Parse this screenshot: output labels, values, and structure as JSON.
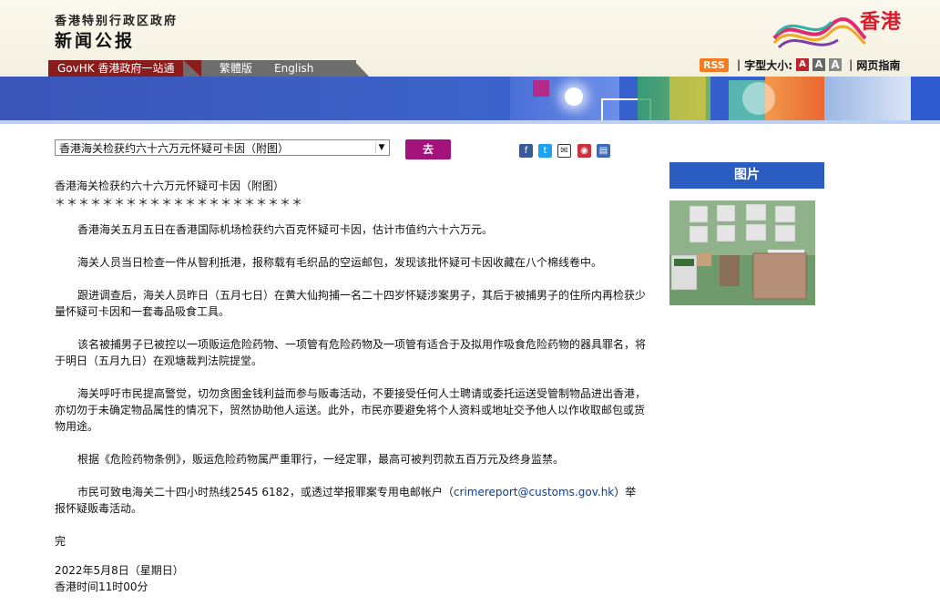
{
  "header": {
    "gov_name": "香港特别行政区政府",
    "site_name": "新闻公报",
    "logo_text": "香港"
  },
  "toolbar": {
    "rss": "RSS",
    "font_size_label": "字型大小:",
    "font_a": "A",
    "guide": "网页指南"
  },
  "nav": {
    "govhk": "GovHK 香港政府一站通",
    "traditional": "繁體版",
    "english": "English"
  },
  "select": {
    "value": "香港海关检获约六十六万元怀疑可卡因（附图）"
  },
  "go_button": "去",
  "article": {
    "title": "香港海关检获约六十六万元怀疑可卡因（附图）",
    "stars": "＊＊＊＊＊＊＊＊＊＊＊＊＊＊＊＊＊＊＊＊＊",
    "p1": "香港海关五月五日在香港国际机场检获约六百克怀疑可卡因，估计市值约六十六万元。",
    "p2": "海关人员当日检查一件从智利抵港，报称载有毛织品的空运邮包，发现该批怀疑可卡因收藏在八个棉线卷中。",
    "p3": "跟进调查后，海关人员昨日（五月七日）在黄大仙拘捕一名二十四岁怀疑涉案男子，其后于被捕男子的住所内再检获少量怀疑可卡因和一套毒品吸食工具。",
    "p4": "该名被捕男子已被控以一项贩运危险药物、一项管有危险药物及一项管有适合于及拟用作吸食危险药物的器具罪名，将于明日（五月九日）在观塘裁判法院提堂。",
    "p5": "海关呼吁市民提高警觉，切勿贪图金钱利益而参与贩毒活动，不要接受任何人士聘请或委托运送受管制物品进出香港，亦切勿于未确定物品属性的情况下，贸然协助他人运送。此外，市民亦要避免将个人资料或地址交予他人以作收取邮包或货物用途。",
    "p6": "根据《危险药物条例》，贩运危险药物属严重罪行，一经定罪，最高可被判罚款五百万元及终身监禁。",
    "p7_pre": "市民可致电海关二十四小时热线2545 6182，或透过举报罪案专用电邮帐户（",
    "p7_link": "crimereport@customs.gov.hk",
    "p7_post": "）举报怀疑贩毒活动。",
    "end": "完",
    "date": "2022年5月8日（星期日）",
    "time": "香港时间11时00分"
  },
  "sidebar": {
    "title": "图片"
  }
}
